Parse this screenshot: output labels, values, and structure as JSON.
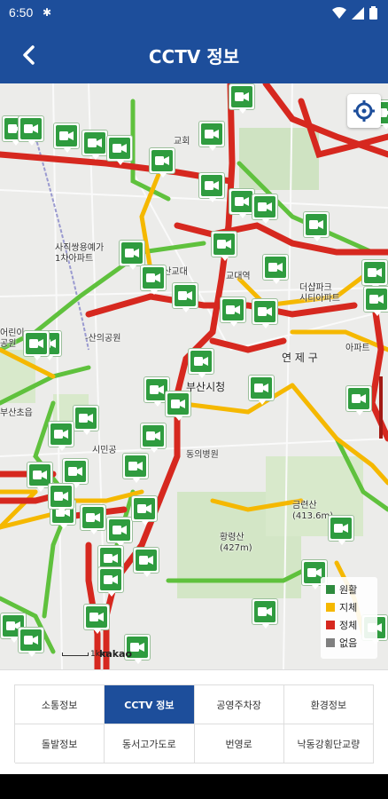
{
  "status_bar": {
    "time": "6:50"
  },
  "header": {
    "title": "CCTV 정보",
    "back_icon": "arrow-left-icon"
  },
  "map": {
    "labels": [
      {
        "key": "sajik",
        "line1": "사직쌍용예가",
        "line2": "1차아파트"
      },
      {
        "key": "busan_univ_station",
        "line1": "부산교대",
        "line2": ""
      },
      {
        "key": "gyodae_station",
        "line1": "교대역",
        "line2": ""
      },
      {
        "key": "theshap",
        "line1": "더샵파크",
        "line2": "시티아파트"
      },
      {
        "key": "yeonje_gu",
        "line1": "연 제 구",
        "line2": ""
      },
      {
        "key": "apart",
        "line1": "아파트",
        "line2": ""
      },
      {
        "key": "city_hall",
        "line1": "부산시청",
        "line2": ""
      },
      {
        "key": "dongeui",
        "line1": "동의병원",
        "line2": ""
      },
      {
        "key": "geumnyeonsan",
        "line1": "금련산",
        "line2": "(413.6m)"
      },
      {
        "key": "hwangnyeongsan",
        "line1": "황령산",
        "line2": "(427m)"
      },
      {
        "key": "park",
        "line1": "-산의공원",
        "line2": ""
      },
      {
        "key": "sajikcho",
        "line1": "부산초읍",
        "line2": ""
      },
      {
        "key": "siminpark",
        "line1": "시민공",
        "line2": ""
      },
      {
        "key": "church",
        "line1": "교회",
        "line2": ""
      },
      {
        "key": "edu",
        "line1": "어린이",
        "line2": "공원"
      }
    ],
    "cctv_count_visible": 46,
    "locate_icon": "crosshair-icon",
    "scale": "1km",
    "provider": "kakao"
  },
  "legend": {
    "items": [
      {
        "label": "원활",
        "color": "#2e8b3e"
      },
      {
        "label": "지체",
        "color": "#f5b800"
      },
      {
        "label": "정체",
        "color": "#d6281f"
      },
      {
        "label": "없음",
        "color": "#808080"
      }
    ]
  },
  "nav": {
    "buttons": [
      {
        "label": "소통정보",
        "active": false
      },
      {
        "label": "CCTV 정보",
        "active": true
      },
      {
        "label": "공영주차장",
        "active": false
      },
      {
        "label": "환경정보",
        "active": false
      },
      {
        "label": "돌발정보",
        "active": false
      },
      {
        "label": "동서고가도로",
        "active": false
      },
      {
        "label": "번영로",
        "active": false
      },
      {
        "label": "낙동강횡단교량",
        "active": false
      }
    ]
  },
  "colors": {
    "header": "#1d4e9b",
    "cctv_green": "#2f9c3f",
    "road_red": "#d6281f",
    "road_yellow": "#f5b800",
    "road_green": "#5fc13d"
  }
}
